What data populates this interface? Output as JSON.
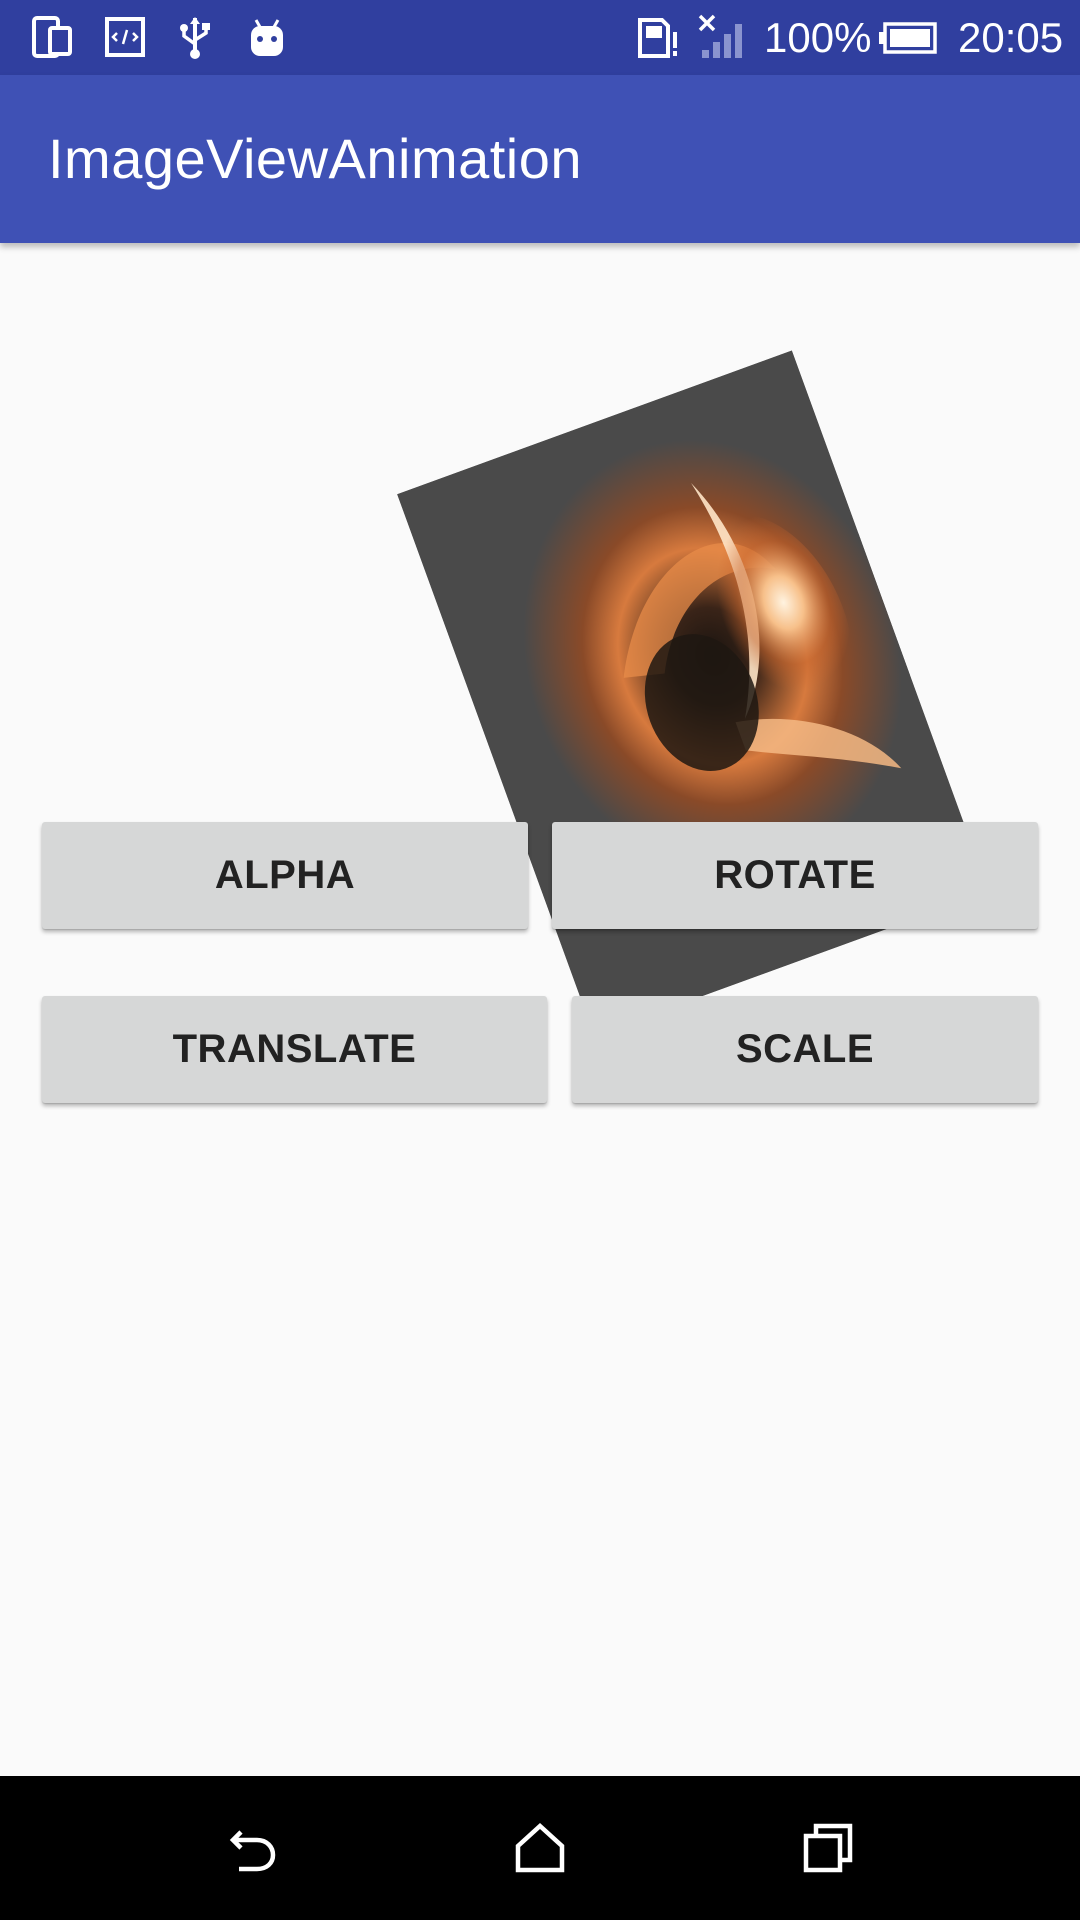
{
  "status_bar": {
    "battery_percent": "100%",
    "time": "20:05",
    "icons": [
      "device-icon",
      "code-icon",
      "usb-icon",
      "android-icon",
      "sim-alert-icon",
      "no-signal-icon",
      "battery-icon"
    ]
  },
  "app_bar": {
    "title": "ImageViewAnimation"
  },
  "buttons": {
    "alpha": "ALPHA",
    "rotate": "ROTATE",
    "translate": "TRANSLATE",
    "scale": "SCALE"
  },
  "nav_bar": {
    "icons": [
      "back-icon",
      "home-icon",
      "recents-icon"
    ]
  },
  "colors": {
    "status_bar": "#303f9f",
    "app_bar": "#3f51b5",
    "background": "#fafafa",
    "button": "#d6d7d7",
    "nav_bar": "#000000"
  }
}
